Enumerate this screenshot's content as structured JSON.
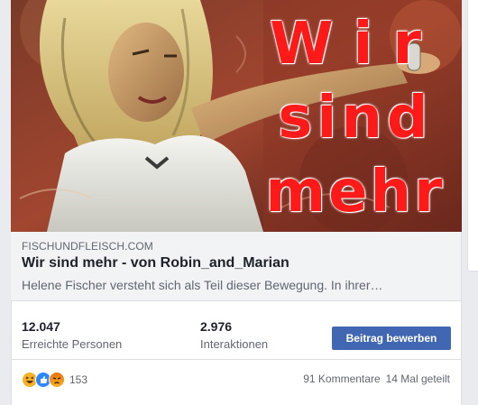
{
  "overlay": {
    "line1": "Wir",
    "line2": "sind",
    "line3": "mehr"
  },
  "link": {
    "domain": "FISCHUNDFLEISCH.COM",
    "title": "Wir sind mehr - von Robin_and_Marian",
    "description": "Helene Fischer versteht sich als Teil dieser Bewegung. In ihrer…"
  },
  "stats": {
    "reach_value": "12.047",
    "reach_label": "Erreichte Personen",
    "engagement_value": "2.976",
    "engagement_label": "Interaktionen",
    "boost_label": "Beitrag bewerben"
  },
  "reactions": {
    "icons": [
      "haha-icon",
      "like-icon",
      "angry-icon"
    ],
    "count": "153",
    "comments": "91 Kommentare",
    "shares": "14 Mal geteilt"
  },
  "colors": {
    "accent": "#4267b2",
    "overlay_text": "#ff1a1a",
    "muted_text": "#606770"
  }
}
